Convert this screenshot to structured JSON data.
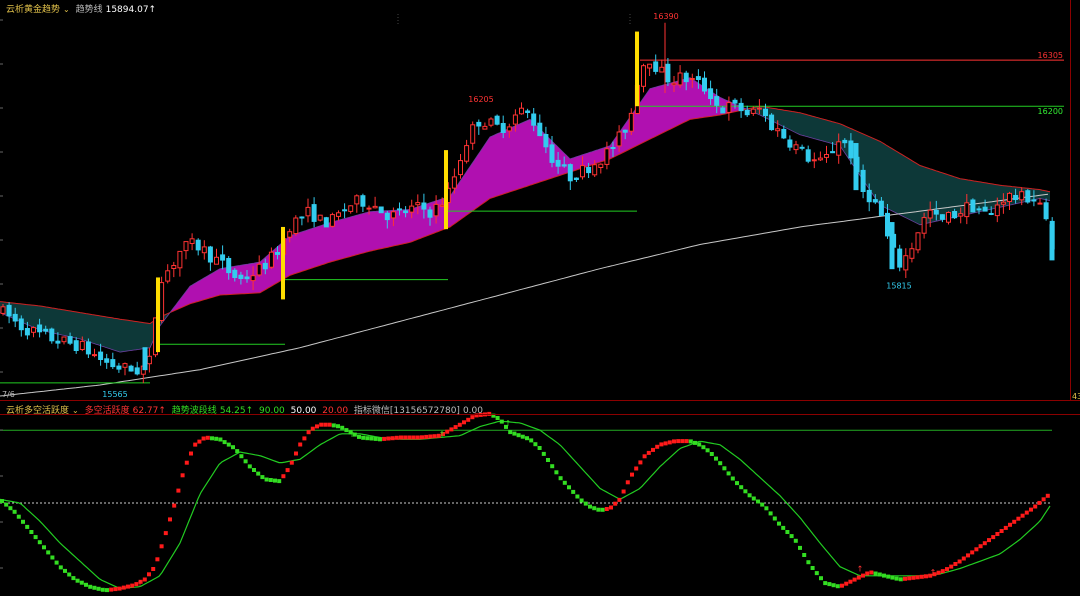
{
  "main_header": {
    "indicator_name": "云析黄金趋势",
    "trend_label": "趋势线",
    "trend_value": "15894.07↑"
  },
  "sub_header": {
    "indicator_name": "云析多空活跃度",
    "item1_label": "多空活跃度",
    "item1_value": "62.77↑",
    "item2_label": "趋势波段线",
    "item2_value": "54.25↑",
    "level_high": "90.00",
    "level_mid": "50.00",
    "level_low": "20.00",
    "contact_label": "指标微信[13156572780]",
    "contact_value": "0.00"
  },
  "colors": {
    "bull_candle": "#ff3333",
    "bear_candle": "#33ccee",
    "signal_candle": "#ffdd00",
    "bull_cloud": "#b010b0",
    "bear_cloud": "#0d3838",
    "ma_long": "#c8c8c8",
    "osc_up": "#ff1a1a",
    "osc_down": "#33dd22",
    "osc_line": "#22cc22"
  },
  "chart_data": [
    {
      "type": "candlestick",
      "ylim": [
        15540,
        16410
      ],
      "annotations": [
        {
          "text": "16390",
          "kind": "high"
        },
        {
          "text": "16305",
          "kind": "resistance"
        },
        {
          "text": "16205",
          "kind": "high"
        },
        {
          "text": "16200",
          "kind": "support"
        },
        {
          "text": "15815",
          "kind": "low"
        },
        {
          "text": "15565",
          "kind": "low"
        }
      ],
      "partial_labels": {
        "left_bottom": "7/6",
        "right_bottom": "43"
      },
      "price_path": [
        [
          0,
          15735
        ],
        [
          10,
          15720
        ],
        [
          20,
          15700
        ],
        [
          30,
          15690
        ],
        [
          40,
          15680
        ],
        [
          50,
          15672
        ],
        [
          60,
          15665
        ],
        [
          70,
          15660
        ],
        [
          80,
          15655
        ],
        [
          90,
          15640
        ],
        [
          100,
          15625
        ],
        [
          110,
          15612
        ],
        [
          120,
          15605
        ],
        [
          130,
          15600
        ],
        [
          140,
          15598
        ],
        [
          150,
          15620
        ],
        [
          160,
          15810
        ],
        [
          170,
          15830
        ],
        [
          180,
          15870
        ],
        [
          190,
          15885
        ],
        [
          200,
          15880
        ],
        [
          210,
          15860
        ],
        [
          220,
          15845
        ],
        [
          230,
          15820
        ],
        [
          240,
          15805
        ],
        [
          250,
          15815
        ],
        [
          260,
          15830
        ],
        [
          270,
          15850
        ],
        [
          280,
          15880
        ],
        [
          290,
          15930
        ],
        [
          300,
          15945
        ],
        [
          310,
          15960
        ],
        [
          320,
          15940
        ],
        [
          330,
          15935
        ],
        [
          340,
          15955
        ],
        [
          350,
          15975
        ],
        [
          360,
          15985
        ],
        [
          370,
          15980
        ],
        [
          380,
          15965
        ],
        [
          390,
          15950
        ],
        [
          400,
          15955
        ],
        [
          410,
          15965
        ],
        [
          420,
          15970
        ],
        [
          430,
          15960
        ],
        [
          440,
          15975
        ],
        [
          450,
          16010
        ],
        [
          460,
          16080
        ],
        [
          470,
          16140
        ],
        [
          480,
          16170
        ],
        [
          490,
          16160
        ],
        [
          500,
          16150
        ],
        [
          510,
          16165
        ],
        [
          520,
          16190
        ],
        [
          530,
          16180
        ],
        [
          540,
          16140
        ],
        [
          550,
          16090
        ],
        [
          560,
          16060
        ],
        [
          570,
          16040
        ],
        [
          580,
          16050
        ],
        [
          590,
          16065
        ],
        [
          600,
          16080
        ],
        [
          610,
          16100
        ],
        [
          620,
          16130
        ],
        [
          630,
          16170
        ],
        [
          640,
          16290
        ],
        [
          650,
          16310
        ],
        [
          660,
          16280
        ],
        [
          670,
          16260
        ],
        [
          680,
          16265
        ],
        [
          690,
          16260
        ],
        [
          700,
          16250
        ],
        [
          710,
          16230
        ],
        [
          720,
          16190
        ],
        [
          730,
          16200
        ],
        [
          740,
          16195
        ],
        [
          750,
          16180
        ],
        [
          760,
          16195
        ],
        [
          770,
          16160
        ],
        [
          780,
          16140
        ],
        [
          790,
          16120
        ],
        [
          800,
          16100
        ],
        [
          810,
          16080
        ],
        [
          820,
          16070
        ],
        [
          830,
          16090
        ],
        [
          840,
          16130
        ],
        [
          850,
          16100
        ],
        [
          860,
          16010
        ],
        [
          870,
          15995
        ],
        [
          880,
          15960
        ],
        [
          890,
          15880
        ],
        [
          900,
          15840
        ],
        [
          910,
          15870
        ],
        [
          920,
          15930
        ],
        [
          930,
          15960
        ],
        [
          940,
          15935
        ],
        [
          950,
          15950
        ],
        [
          960,
          15960
        ],
        [
          970,
          15975
        ],
        [
          980,
          15965
        ],
        [
          990,
          15945
        ],
        [
          1000,
          15990
        ],
        [
          1010,
          15995
        ],
        [
          1020,
          15990
        ],
        [
          1030,
          15995
        ],
        [
          1040,
          15980
        ],
        [
          1048,
          15920
        ],
        [
          1054,
          15850
        ]
      ],
      "cloud": [
        [
          0,
          15730,
          15755
        ],
        [
          40,
          15690,
          15745
        ],
        [
          80,
          15670,
          15730
        ],
        [
          120,
          15640,
          15715
        ],
        [
          150,
          15650,
          15705
        ],
        [
          160,
          15700,
          15720
        ],
        [
          190,
          15790,
          15750
        ],
        [
          220,
          15830,
          15770
        ],
        [
          260,
          15845,
          15775
        ],
        [
          290,
          15905,
          15815
        ],
        [
          330,
          15935,
          15845
        ],
        [
          370,
          15960,
          15870
        ],
        [
          410,
          15965,
          15890
        ],
        [
          450,
          15995,
          15925
        ],
        [
          490,
          16130,
          15990
        ],
        [
          530,
          16170,
          16020
        ],
        [
          570,
          16080,
          16050
        ],
        [
          610,
          16110,
          16080
        ],
        [
          650,
          16240,
          16125
        ],
        [
          690,
          16265,
          16170
        ],
        [
          720,
          16220,
          16180
        ],
        [
          760,
          16180,
          16200
        ],
        [
          800,
          16135,
          16185
        ],
        [
          840,
          16110,
          16160
        ],
        [
          880,
          15975,
          16120
        ],
        [
          920,
          15930,
          16065
        ],
        [
          960,
          15950,
          16035
        ],
        [
          1000,
          15970,
          16020
        ],
        [
          1040,
          15990,
          16010
        ],
        [
          1050,
          15985,
          16005
        ]
      ],
      "ma_long": [
        [
          0,
          15540
        ],
        [
          100,
          15565
        ],
        [
          200,
          15600
        ],
        [
          300,
          15650
        ],
        [
          400,
          15710
        ],
        [
          500,
          15770
        ],
        [
          600,
          15830
        ],
        [
          700,
          15885
        ],
        [
          800,
          15925
        ],
        [
          900,
          15955
        ],
        [
          1000,
          15985
        ],
        [
          1050,
          16000
        ]
      ],
      "signal_bars": [
        [
          158,
          15640,
          15810
        ],
        [
          283,
          15760,
          15925
        ],
        [
          446,
          15920,
          16100
        ],
        [
          637,
          16200,
          16370
        ]
      ],
      "levels": [
        {
          "x0": 158,
          "x1": 285,
          "y": 15658,
          "color": "#22cc22"
        },
        {
          "x0": 285,
          "x1": 448,
          "y": 15805,
          "color": "#22cc22"
        },
        {
          "x0": 448,
          "x1": 637,
          "y": 15961,
          "color": "#22cc22"
        },
        {
          "x0": 637,
          "x1": 1064,
          "y": 16200,
          "color": "#22cc22"
        },
        {
          "x0": 640,
          "x1": 1064,
          "y": 16305,
          "color": "#ff3333"
        },
        {
          "x0": 0,
          "x1": 150,
          "y": 15570,
          "color": "#22cc22"
        }
      ]
    },
    {
      "type": "oscillator",
      "ylim": [
        0,
        100
      ],
      "levels": [
        90,
        50,
        20
      ],
      "activity": [
        [
          0,
          52
        ],
        [
          15,
          45
        ],
        [
          30,
          35
        ],
        [
          45,
          25
        ],
        [
          60,
          15
        ],
        [
          75,
          8
        ],
        [
          90,
          4
        ],
        [
          105,
          2
        ],
        [
          120,
          3
        ],
        [
          135,
          5
        ],
        [
          145,
          8
        ],
        [
          155,
          15
        ],
        [
          165,
          32
        ],
        [
          175,
          50
        ],
        [
          185,
          70
        ],
        [
          195,
          82
        ],
        [
          205,
          86
        ],
        [
          220,
          85
        ],
        [
          235,
          80
        ],
        [
          250,
          70
        ],
        [
          265,
          63
        ],
        [
          280,
          62
        ],
        [
          290,
          70
        ],
        [
          300,
          82
        ],
        [
          310,
          90
        ],
        [
          320,
          93
        ],
        [
          330,
          93
        ],
        [
          340,
          92
        ],
        [
          350,
          89
        ],
        [
          360,
          86
        ],
        [
          380,
          85
        ],
        [
          400,
          86
        ],
        [
          420,
          86
        ],
        [
          440,
          87
        ],
        [
          460,
          93
        ],
        [
          475,
          98
        ],
        [
          490,
          99
        ],
        [
          500,
          96
        ],
        [
          510,
          89
        ],
        [
          520,
          87
        ],
        [
          530,
          85
        ],
        [
          540,
          80
        ],
        [
          550,
          72
        ],
        [
          560,
          64
        ],
        [
          570,
          58
        ],
        [
          580,
          52
        ],
        [
          590,
          48
        ],
        [
          600,
          46
        ],
        [
          610,
          47
        ],
        [
          620,
          52
        ],
        [
          630,
          64
        ],
        [
          645,
          76
        ],
        [
          660,
          82
        ],
        [
          675,
          84
        ],
        [
          690,
          84
        ],
        [
          700,
          82
        ],
        [
          710,
          78
        ],
        [
          720,
          72
        ],
        [
          735,
          62
        ],
        [
          750,
          54
        ],
        [
          765,
          48
        ],
        [
          780,
          38
        ],
        [
          795,
          30
        ],
        [
          810,
          16
        ],
        [
          825,
          6
        ],
        [
          840,
          4
        ],
        [
          855,
          8
        ],
        [
          870,
          12
        ],
        [
          885,
          10
        ],
        [
          900,
          8
        ],
        [
          915,
          9
        ],
        [
          930,
          10
        ],
        [
          945,
          13
        ],
        [
          960,
          18
        ],
        [
          975,
          24
        ],
        [
          990,
          30
        ],
        [
          1005,
          36
        ],
        [
          1020,
          42
        ],
        [
          1035,
          48
        ],
        [
          1050,
          55
        ]
      ],
      "trend_line": [
        [
          0,
          52
        ],
        [
          20,
          50
        ],
        [
          40,
          40
        ],
        [
          60,
          28
        ],
        [
          80,
          18
        ],
        [
          100,
          8
        ],
        [
          120,
          3
        ],
        [
          140,
          4
        ],
        [
          160,
          10
        ],
        [
          180,
          28
        ],
        [
          200,
          55
        ],
        [
          220,
          72
        ],
        [
          240,
          78
        ],
        [
          260,
          76
        ],
        [
          280,
          72
        ],
        [
          300,
          74
        ],
        [
          320,
          82
        ],
        [
          340,
          88
        ],
        [
          360,
          88
        ],
        [
          380,
          86
        ],
        [
          400,
          85
        ],
        [
          420,
          85
        ],
        [
          440,
          86
        ],
        [
          460,
          87
        ],
        [
          480,
          92
        ],
        [
          500,
          95
        ],
        [
          520,
          94
        ],
        [
          540,
          90
        ],
        [
          560,
          82
        ],
        [
          580,
          70
        ],
        [
          600,
          58
        ],
        [
          620,
          52
        ],
        [
          640,
          58
        ],
        [
          660,
          70
        ],
        [
          680,
          80
        ],
        [
          700,
          84
        ],
        [
          720,
          82
        ],
        [
          740,
          74
        ],
        [
          760,
          64
        ],
        [
          780,
          54
        ],
        [
          800,
          42
        ],
        [
          820,
          28
        ],
        [
          840,
          15
        ],
        [
          860,
          10
        ],
        [
          880,
          10
        ],
        [
          900,
          10
        ],
        [
          920,
          10
        ],
        [
          940,
          11
        ],
        [
          960,
          14
        ],
        [
          980,
          18
        ],
        [
          1000,
          22
        ],
        [
          1020,
          30
        ],
        [
          1040,
          40
        ],
        [
          1052,
          50
        ]
      ]
    }
  ]
}
